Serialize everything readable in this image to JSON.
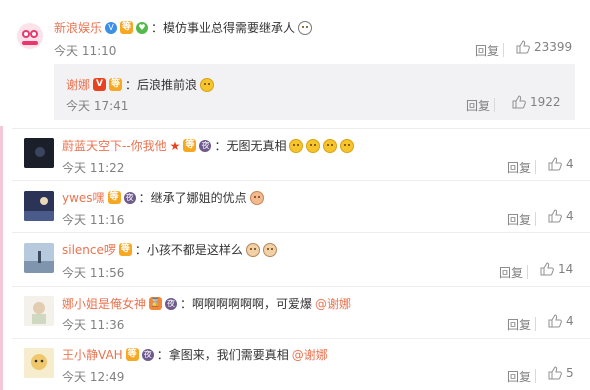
{
  "main_comment": {
    "user": "新浪娱乐",
    "text": "：模仿事业总得需要继承人",
    "time": "今天 11:10",
    "reply_label": "回复",
    "like_count": "23399"
  },
  "nested_reply": {
    "user": "谢娜",
    "text": "：后浪推前浪",
    "time": "今天 17:41",
    "reply_label": "回复",
    "like_count": "1922"
  },
  "replies": [
    {
      "user": "蔚蓝天空下--你我他",
      "text": "：无图无真相",
      "time": "今天 11:22",
      "reply_label": "回复",
      "like_count": "4"
    },
    {
      "user": "ywes嘿",
      "text": "：继承了娜姐的优点",
      "time": "今天 11:16",
      "reply_label": "回复",
      "like_count": "4"
    },
    {
      "user": "silence啰",
      "text": "：小孩不都是这样么",
      "time": "今天 11:56",
      "reply_label": "回复",
      "like_count": "14"
    },
    {
      "user": "娜小姐是俺女神",
      "text": "：啊啊啊啊啊啊，可爱爆",
      "mention": "@谢娜",
      "time": "今天 11:36",
      "reply_label": "回复",
      "like_count": "4"
    },
    {
      "user": "王小静VAH",
      "text": "：拿图来，我们需要真相",
      "mention": "@谢娜",
      "time": "今天 12:49",
      "reply_label": "回复",
      "like_count": "5"
    }
  ],
  "colors": {
    "username": "#eb7350",
    "meta": "#808080",
    "nested_bg": "#f2f2f5",
    "left_bar": "#f2c9d4"
  },
  "icons": {
    "verified": "verified-v-icon",
    "level": "level-icon",
    "vip": "vip-icon",
    "like": "thumb-up-icon",
    "emoji": "emoji-icon"
  }
}
